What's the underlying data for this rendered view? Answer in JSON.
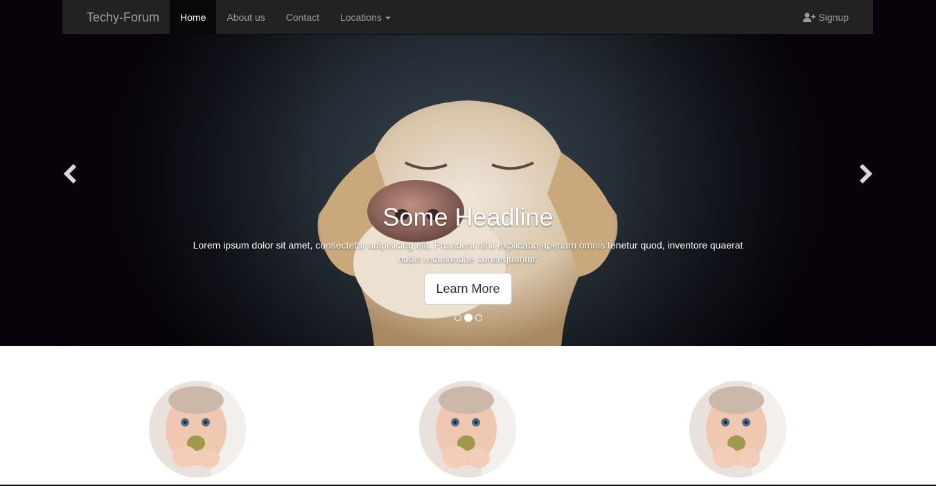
{
  "navbar": {
    "brand": "Techy-Forum",
    "items": [
      {
        "label": "Home",
        "active": true
      },
      {
        "label": "About us",
        "active": false
      },
      {
        "label": "Contact",
        "active": false
      },
      {
        "label": "Locations",
        "active": false,
        "dropdown": true
      }
    ],
    "signup_label": "Signup",
    "signup_icon": "user-plus-icon",
    "bg_color": "#222222",
    "active_bg_color": "#080808"
  },
  "carousel": {
    "headline": "Some Headline",
    "text": "Lorem ipsum dolor sit amet, consectetur adipisicing elit. Provident nihil explicabo aperiam omnis tenetur quod, inventore quaerat nobis recusandae consequuntur.",
    "button_label": "Learn More",
    "slide_count": 3,
    "active_slide": 2,
    "prev_icon": "chevron-left-icon",
    "next_icon": "chevron-right-icon"
  },
  "thumbnails": [
    {
      "image": "baby-portrait"
    },
    {
      "image": "baby-portrait"
    },
    {
      "image": "baby-portrait"
    }
  ]
}
